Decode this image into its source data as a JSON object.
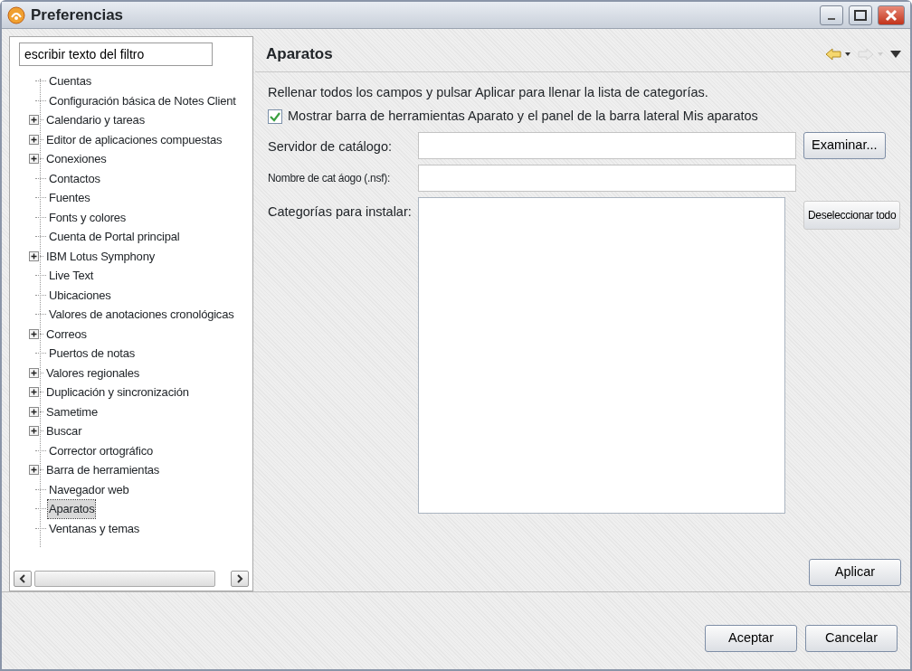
{
  "window": {
    "title": "Preferencias"
  },
  "filter": {
    "value": "escribir texto del filtro"
  },
  "tree": {
    "items": [
      {
        "label": "Cuentas",
        "expandable": false,
        "selected": false
      },
      {
        "label": "Configuración básica de Notes Client",
        "expandable": false,
        "selected": false
      },
      {
        "label": "Calendario y tareas",
        "expandable": true,
        "selected": false
      },
      {
        "label": "Editor de aplicaciones compuestas",
        "expandable": true,
        "selected": false
      },
      {
        "label": "Conexiones",
        "expandable": true,
        "selected": false
      },
      {
        "label": "Contactos",
        "expandable": false,
        "selected": false
      },
      {
        "label": "Fuentes",
        "expandable": false,
        "selected": false
      },
      {
        "label": "Fonts y colores",
        "expandable": false,
        "selected": false
      },
      {
        "label": "Cuenta de Portal principal",
        "expandable": false,
        "selected": false
      },
      {
        "label": "IBM Lotus Symphony",
        "expandable": true,
        "selected": false
      },
      {
        "label": "Live Text",
        "expandable": false,
        "selected": false
      },
      {
        "label": "Ubicaciones",
        "expandable": false,
        "selected": false
      },
      {
        "label": "Valores de anotaciones cronológicas",
        "expandable": false,
        "selected": false
      },
      {
        "label": "Correos",
        "expandable": true,
        "selected": false
      },
      {
        "label": "Puertos de notas",
        "expandable": false,
        "selected": false
      },
      {
        "label": "Valores regionales",
        "expandable": true,
        "selected": false
      },
      {
        "label": "Duplicación y sincronización",
        "expandable": true,
        "selected": false
      },
      {
        "label": "Sametime",
        "expandable": true,
        "selected": false
      },
      {
        "label": "Buscar",
        "expandable": true,
        "selected": false
      },
      {
        "label": "Corrector ortográfico",
        "expandable": false,
        "selected": false
      },
      {
        "label": "Barra de herramientas",
        "expandable": true,
        "selected": false
      },
      {
        "label": "Navegador web",
        "expandable": false,
        "selected": false
      },
      {
        "label": "Aparatos",
        "expandable": false,
        "selected": true
      },
      {
        "label": "Ventanas y temas",
        "expandable": false,
        "selected": false
      }
    ]
  },
  "page": {
    "title": "Aparatos",
    "nav": {
      "back_enabled": true,
      "forward_enabled": false
    },
    "description": "Rellenar todos los campos y pulsar Aplicar para llenar la lista de categorías.",
    "show_toolbar": {
      "label": "Mostrar barra de herramientas Aparato y el panel de la barra lateral Mis aparatos",
      "checked": true
    },
    "fields": [
      {
        "kind": "text",
        "label": "Servidor de catálogo:",
        "button": "Examinar..."
      },
      {
        "kind": "text",
        "label": "Nombre de cat áogo (.nsf):",
        "small": true
      },
      {
        "kind": "list",
        "label": "Categorías para instalar:",
        "button": "Deseleccionar todo"
      }
    ],
    "apply_button": "Aplicar"
  },
  "footer_buttons": [
    "Aceptar",
    "Cancelar"
  ]
}
